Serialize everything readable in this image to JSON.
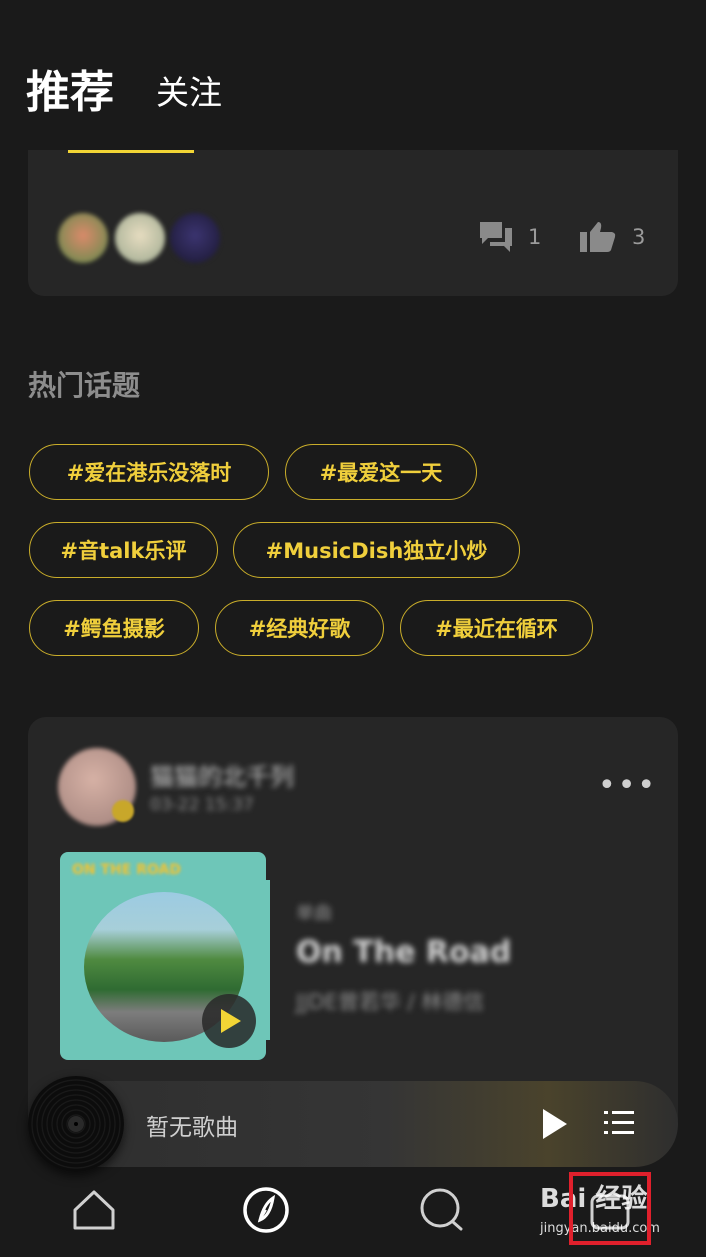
{
  "header": {
    "tab_recommend": "推荐",
    "tab_follow": "关注"
  },
  "top_card": {
    "comment_count": "1",
    "like_count": "3"
  },
  "topics": {
    "title": "热门话题",
    "chips": [
      "#爱在港乐没落时",
      "#最爱这一天",
      "#音talk乐评",
      "#MusicDish独立小炒",
      "#鳄鱼摄影",
      "#经典好歌",
      "#最近在循环"
    ]
  },
  "post": {
    "username": "猫猫的北千列",
    "time": "03-22 15:37",
    "more_icon": "•••",
    "song": {
      "label": "单曲",
      "title": "On The Road",
      "artist": "JJDE曾若华 / 林德信",
      "cover_title": "ON THE ROAD"
    }
  },
  "player": {
    "status": "暂无歌曲"
  },
  "nav": {
    "items": [
      "home-icon",
      "discover-icon",
      "search-icon",
      "profile-icon"
    ]
  },
  "watermark": {
    "main": "Bai 经验",
    "sub": "jingyan.baidu.com"
  },
  "colors": {
    "accent": "#f2d535",
    "background": "#1a1a1a",
    "card": "#262626",
    "highlight_box": "#e0202c"
  }
}
